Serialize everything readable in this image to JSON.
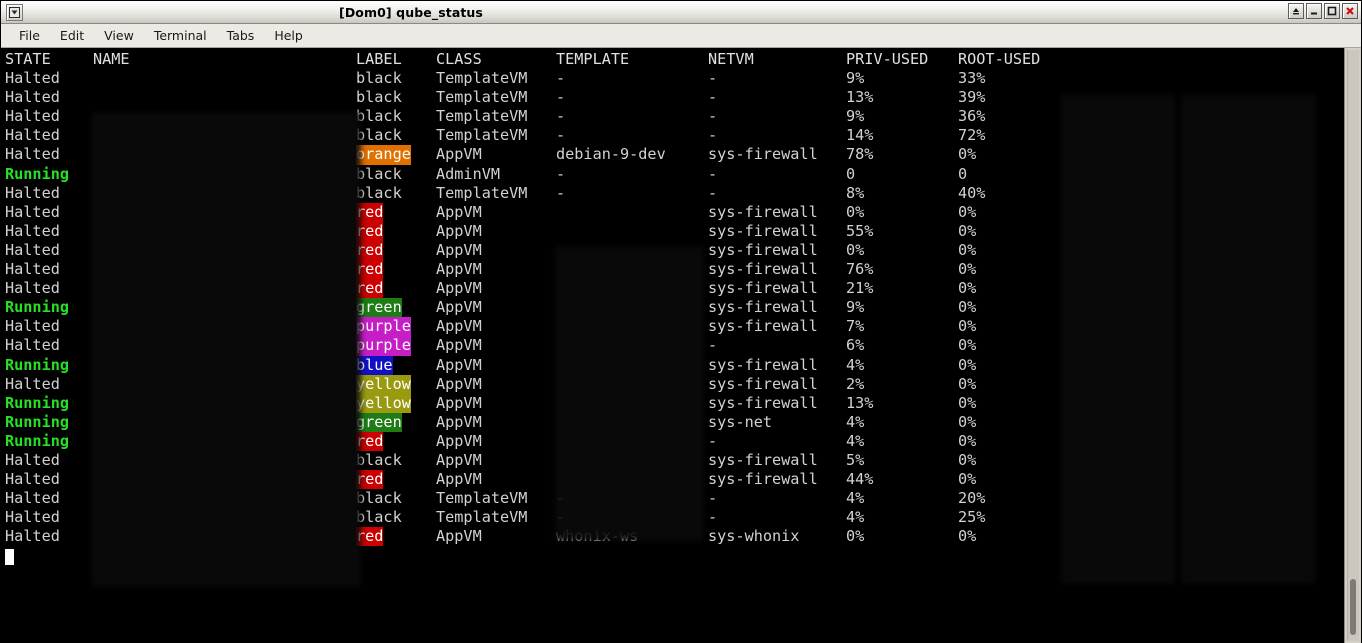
{
  "window": {
    "title": "[Dom0] qube_status",
    "menu_icon": "window-menu-icon",
    "controls": [
      {
        "name": "shade-button",
        "glyph": "▲"
      },
      {
        "name": "minimize-button",
        "glyph": "_"
      },
      {
        "name": "maximize-button",
        "glyph": "❐"
      },
      {
        "name": "close-button",
        "glyph": "✕"
      }
    ]
  },
  "menubar": {
    "items": [
      {
        "label": "File"
      },
      {
        "label": "Edit"
      },
      {
        "label": "View"
      },
      {
        "label": "Terminal"
      },
      {
        "label": "Tabs"
      },
      {
        "label": "Help"
      }
    ]
  },
  "terminal": {
    "headers": {
      "state": "STATE",
      "name": "NAME",
      "label": "LABEL",
      "class": "CLASS",
      "template": "TEMPLATE",
      "netvm": "NETVM",
      "priv_used": "PRIV-USED",
      "root_used": "ROOT-USED"
    },
    "rows": [
      {
        "state": "Halted",
        "name": "",
        "label": "black",
        "label_color": "black",
        "class": "TemplateVM",
        "template": "-",
        "netvm": "-",
        "priv": "9%",
        "root": "33%"
      },
      {
        "state": "Halted",
        "name": "",
        "label": "black",
        "label_color": "black",
        "class": "TemplateVM",
        "template": "-",
        "netvm": "-",
        "priv": "13%",
        "root": "39%"
      },
      {
        "state": "Halted",
        "name": "",
        "label": "black",
        "label_color": "black",
        "class": "TemplateVM",
        "template": "-",
        "netvm": "-",
        "priv": "9%",
        "root": "36%"
      },
      {
        "state": "Halted",
        "name": "",
        "label": "black",
        "label_color": "black",
        "class": "TemplateVM",
        "template": "-",
        "netvm": "-",
        "priv": "14%",
        "root": "72%"
      },
      {
        "state": "Halted",
        "name": "",
        "label": "orange",
        "label_color": "orange",
        "class": "AppVM",
        "template": "debian-9-dev",
        "netvm": "sys-firewall",
        "priv": "78%",
        "root": "0%"
      },
      {
        "state": "Running",
        "name": "",
        "label": "black",
        "label_color": "black",
        "class": "AdminVM",
        "template": "-",
        "netvm": "-",
        "priv": "0",
        "root": "0"
      },
      {
        "state": "Halted",
        "name": "",
        "label": "black",
        "label_color": "black",
        "class": "TemplateVM",
        "template": "-",
        "netvm": "-",
        "priv": "8%",
        "root": "40%"
      },
      {
        "state": "Halted",
        "name": "",
        "label": "red",
        "label_color": "red",
        "class": "AppVM",
        "template": "",
        "netvm": "sys-firewall",
        "priv": "0%",
        "root": "0%"
      },
      {
        "state": "Halted",
        "name": "",
        "label": "red",
        "label_color": "red",
        "class": "AppVM",
        "template": "",
        "netvm": "sys-firewall",
        "priv": "55%",
        "root": "0%"
      },
      {
        "state": "Halted",
        "name": "",
        "label": "red",
        "label_color": "red",
        "class": "AppVM",
        "template": "",
        "netvm": "sys-firewall",
        "priv": "0%",
        "root": "0%"
      },
      {
        "state": "Halted",
        "name": "",
        "label": "red",
        "label_color": "red",
        "class": "AppVM",
        "template": "",
        "netvm": "sys-firewall",
        "priv": "76%",
        "root": "0%"
      },
      {
        "state": "Halted",
        "name": "",
        "label": "red",
        "label_color": "red",
        "class": "AppVM",
        "template": "",
        "netvm": "sys-firewall",
        "priv": "21%",
        "root": "0%"
      },
      {
        "state": "Running",
        "name": "",
        "label": "green",
        "label_color": "green",
        "class": "AppVM",
        "template": "",
        "netvm": "sys-firewall",
        "priv": "9%",
        "root": "0%"
      },
      {
        "state": "Halted",
        "name": "",
        "label": "purple",
        "label_color": "purple",
        "class": "AppVM",
        "template": "",
        "netvm": "sys-firewall",
        "priv": "7%",
        "root": "0%"
      },
      {
        "state": "Halted",
        "name": "",
        "label": "purple",
        "label_color": "purple",
        "class": "AppVM",
        "template": "",
        "netvm": "-",
        "priv": "6%",
        "root": "0%"
      },
      {
        "state": "Running",
        "name": "",
        "label": "blue",
        "label_color": "blue",
        "class": "AppVM",
        "template": "",
        "netvm": "sys-firewall",
        "priv": "4%",
        "root": "0%"
      },
      {
        "state": "Halted",
        "name": "",
        "label": "yellow",
        "label_color": "yellow",
        "class": "AppVM",
        "template": "",
        "netvm": "sys-firewall",
        "priv": "2%",
        "root": "0%"
      },
      {
        "state": "Running",
        "name": "",
        "label": "yellow",
        "label_color": "yellow",
        "class": "AppVM",
        "template": "",
        "netvm": "sys-firewall",
        "priv": "13%",
        "root": "0%"
      },
      {
        "state": "Running",
        "name": "",
        "label": "green",
        "label_color": "green",
        "class": "AppVM",
        "template": "",
        "netvm": "sys-net",
        "priv": "4%",
        "root": "0%"
      },
      {
        "state": "Running",
        "name": "",
        "label": "red",
        "label_color": "red",
        "class": "AppVM",
        "template": "",
        "netvm": "-",
        "priv": "4%",
        "root": "0%"
      },
      {
        "state": "Halted",
        "name": "",
        "label": "black",
        "label_color": "black",
        "class": "AppVM",
        "template": "",
        "netvm": "sys-firewall",
        "priv": "5%",
        "root": "0%"
      },
      {
        "state": "Halted",
        "name": "",
        "label": "red",
        "label_color": "red",
        "class": "AppVM",
        "template": "",
        "netvm": "sys-firewall",
        "priv": "44%",
        "root": "0%"
      },
      {
        "state": "Halted",
        "name": "",
        "label": "black",
        "label_color": "black",
        "class": "TemplateVM",
        "template": "-",
        "netvm": "-",
        "priv": "4%",
        "root": "20%"
      },
      {
        "state": "Halted",
        "name": "",
        "label": "black",
        "label_color": "black",
        "class": "TemplateVM",
        "template": "-",
        "netvm": "-",
        "priv": "4%",
        "root": "25%"
      },
      {
        "state": "Halted",
        "name": "",
        "label": "red",
        "label_color": "red",
        "class": "AppVM",
        "template": "whonix-ws",
        "netvm": "sys-whonix",
        "priv": "0%",
        "root": "0%"
      }
    ]
  },
  "colors": {
    "label_red": "#cc0000",
    "label_orange": "#e07000",
    "label_green": "#1d7c14",
    "label_purple": "#c61ec6",
    "label_blue": "#1111c4",
    "label_yellow": "#9a9a11",
    "state_running": "#25e025",
    "terminal_bg": "#000000",
    "terminal_fg": "#d2d2d2"
  }
}
